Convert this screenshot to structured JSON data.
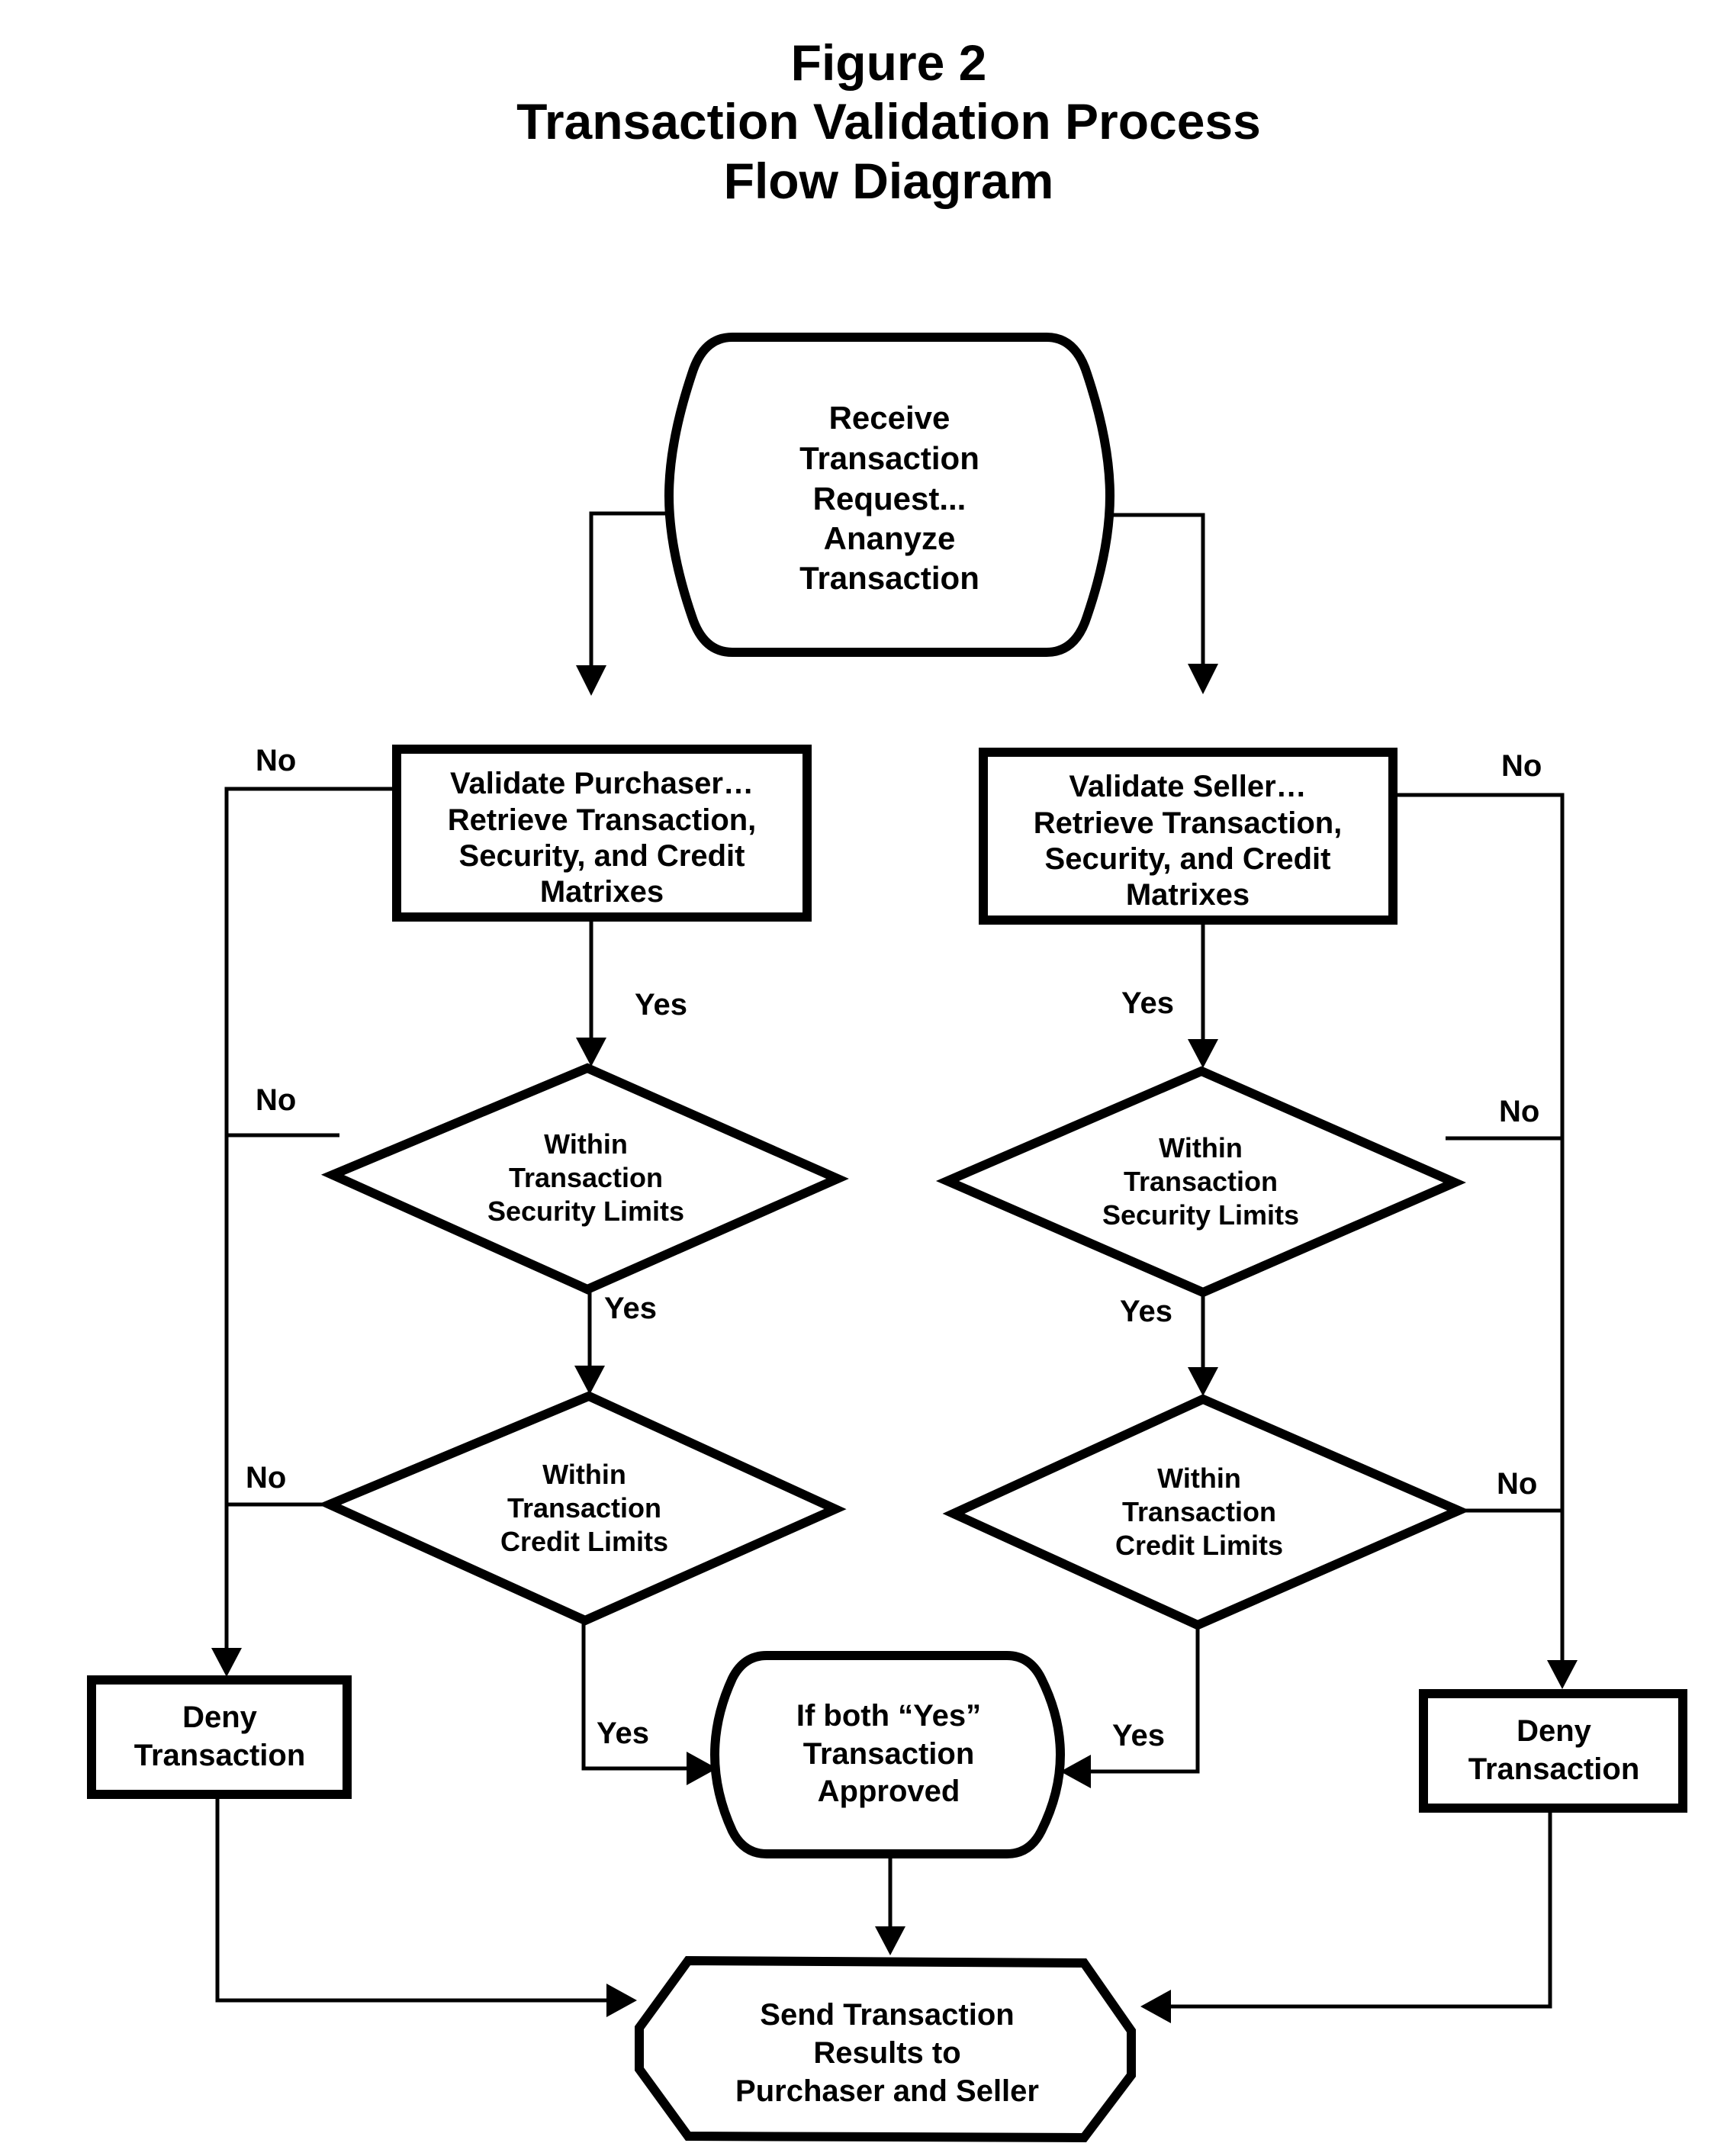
{
  "title": {
    "lines": [
      "Figure 2",
      "Transaction Validation Process",
      "Flow Diagram"
    ]
  },
  "nodes": {
    "receive": [
      "Receive",
      "Transaction",
      "Request...",
      "Ananyze",
      "Transaction"
    ],
    "validate_purchaser": [
      "Validate Purchaser…",
      "Retrieve Transaction,",
      "Security, and Credit",
      "Matrixes"
    ],
    "validate_seller": [
      "Validate Seller…",
      "Retrieve Transaction,",
      "Security, and Credit",
      "Matrixes"
    ],
    "purchaser_security": [
      "Within",
      "Transaction",
      "Security Limits"
    ],
    "seller_security": [
      "Within",
      "Transaction",
      "Security Limits"
    ],
    "purchaser_credit": [
      "Within",
      "Transaction",
      "Credit Limits"
    ],
    "seller_credit": [
      "Within",
      "Transaction",
      "Credit Limits"
    ],
    "deny_left": [
      "Deny",
      "Transaction"
    ],
    "deny_right": [
      "Deny",
      "Transaction"
    ],
    "approved": [
      "If both “Yes”",
      "Transaction",
      "Approved"
    ],
    "send": [
      "Send Transaction",
      "Results to",
      "Purchaser and Seller"
    ]
  },
  "edge_labels": {
    "yes": "Yes",
    "no": "No"
  }
}
